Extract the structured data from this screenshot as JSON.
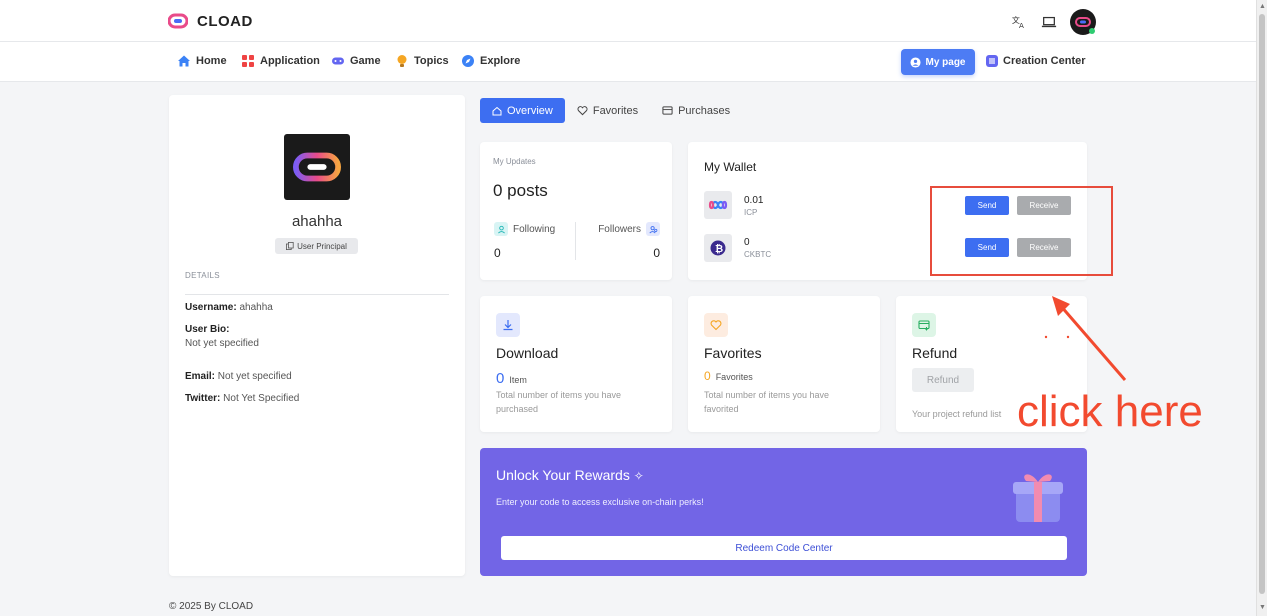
{
  "app": {
    "name": "CLOAD"
  },
  "nav": {
    "items": [
      {
        "label": "Home",
        "icon": "house-icon"
      },
      {
        "label": "Application",
        "icon": "grid-icon"
      },
      {
        "label": "Game",
        "icon": "gamepad-icon"
      },
      {
        "label": "Topics",
        "icon": "lightbulb-icon"
      },
      {
        "label": "Explore",
        "icon": "compass-icon"
      }
    ],
    "my_page": "My page",
    "creation_center": "Creation Center"
  },
  "top_icons": [
    "translate-icon",
    "laptop-icon",
    "avatar"
  ],
  "profile": {
    "username": "ahahha",
    "principal_label": "User Principal",
    "details_heading": "DETAILS",
    "username_label": "Username:",
    "username_value": "ahahha",
    "bio_label": "User Bio:",
    "bio_value": "Not yet specified",
    "email_label": "Email:",
    "email_value": "Not yet specified",
    "twitter_label": "Twitter:",
    "twitter_value": "Not Yet Specified"
  },
  "tabs": [
    {
      "label": "Overview",
      "active": true
    },
    {
      "label": "Favorites",
      "active": false
    },
    {
      "label": "Purchases",
      "active": false
    }
  ],
  "updates": {
    "title": "My Updates",
    "posts": "0 posts",
    "following_label": "Following",
    "following_count": "0",
    "followers_label": "Followers",
    "followers_count": "0"
  },
  "wallet": {
    "title": "My Wallet",
    "tokens": [
      {
        "amount": "0.01",
        "symbol": "ICP",
        "send": "Send",
        "receive": "Receive"
      },
      {
        "amount": "0",
        "symbol": "CKBTC",
        "send": "Send",
        "receive": "Receive"
      }
    ]
  },
  "stats": {
    "download": {
      "title": "Download",
      "count": "0",
      "unit": "Item",
      "desc": "Total number of items you have purchased"
    },
    "favorites": {
      "title": "Favorites",
      "count": "0",
      "unit": "Favorites",
      "desc": "Total number of items you have favorited"
    },
    "refund": {
      "title": "Refund",
      "button": "Refund",
      "desc": "Your project refund list"
    }
  },
  "rewards": {
    "title": "Unlock Your Rewards",
    "subtitle": "Enter your code to access exclusive on-chain perks!",
    "button": "Redeem Code Center"
  },
  "footer": "© 2025 By CLOAD",
  "annotation": {
    "text": "click here",
    "color": "#f24a2f"
  },
  "colors": {
    "primary": "#3d6ef1",
    "reward_bg": "#7265e6",
    "accent_orange": "#f5a623"
  }
}
